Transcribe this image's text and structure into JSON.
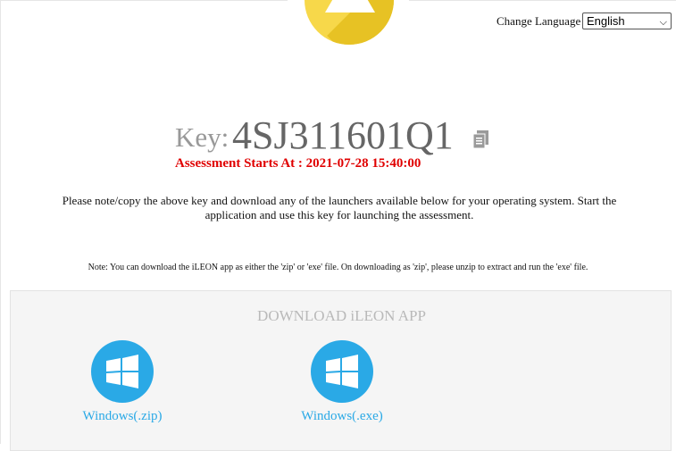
{
  "header": {
    "warning_icon": "warning-icon",
    "change_language_label": "Change Language",
    "language_selected": "English"
  },
  "key": {
    "label": "Key:",
    "value": "4SJ311601Q1",
    "copy_icon": "copy-icon"
  },
  "assessment": {
    "start_text": "Assessment Starts At : 2021-07-28 15:40:00"
  },
  "instructions": {
    "main": "Please note/copy the above key and download any of the launchers available below for your operating system. Start the application and use this key for launching the assessment.",
    "note": "Note: You can download the iLEON app as either the 'zip' or 'exe' file. On downloading as 'zip', please unzip to extract and run the 'exe' file."
  },
  "download": {
    "title": "DOWNLOAD iLEON APP",
    "apps": [
      {
        "icon": "windows-icon",
        "label": "Windows(.zip)"
      },
      {
        "icon": "windows-icon",
        "label": "Windows(.exe)"
      }
    ]
  },
  "colors": {
    "accent_blue": "#2aa9e6",
    "alert_red": "#e00000",
    "warning_yellow": "#f7d84a"
  }
}
